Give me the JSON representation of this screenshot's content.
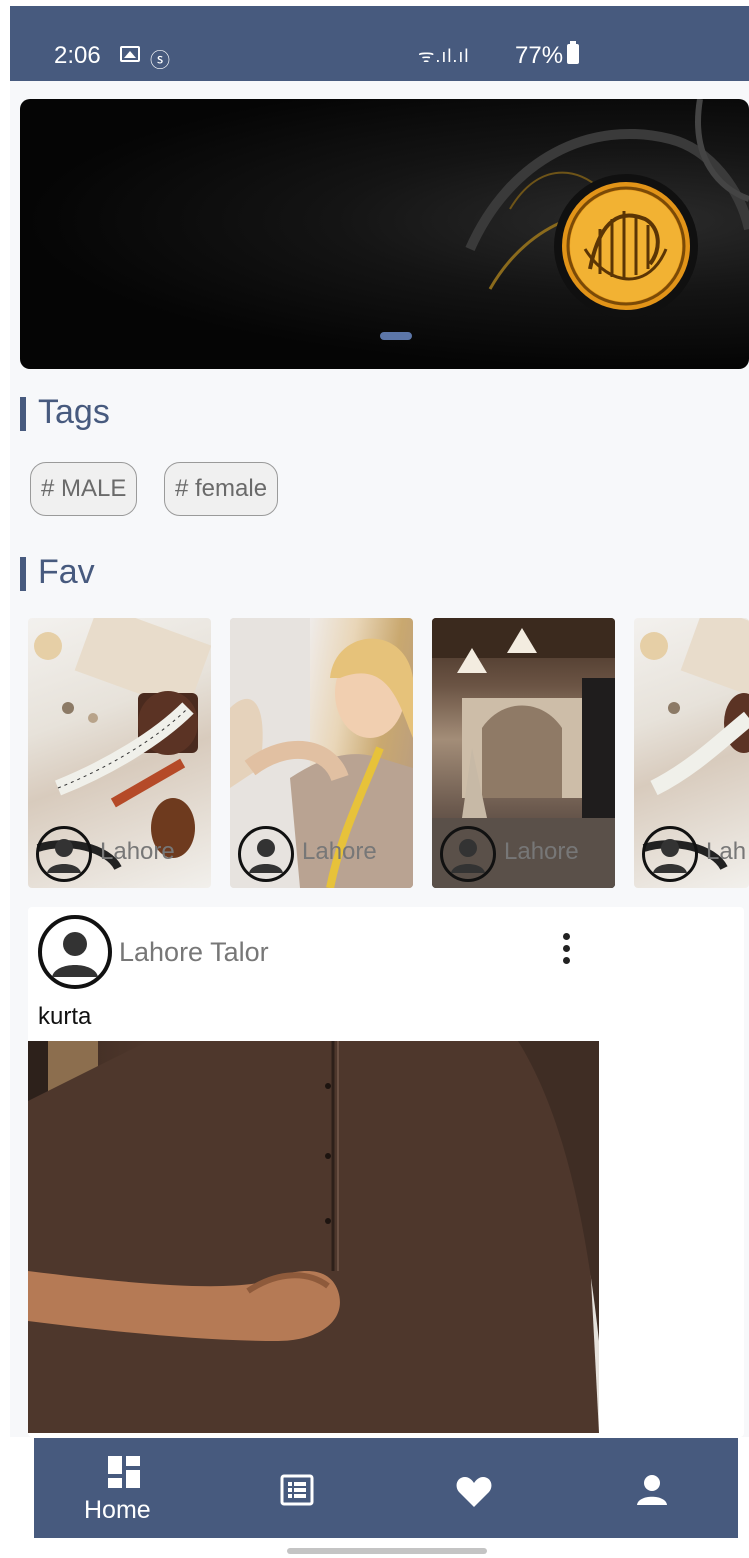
{
  "status_bar": {
    "time": "2:06",
    "battery_percent": "77%",
    "signal_text": "ᯤ.ıl.ıl",
    "notification_icon": "ⓢ",
    "icons": [
      "gallery-icon",
      "notification-icon",
      "wifi-icon",
      "signal-icon",
      "battery-icon"
    ]
  },
  "banner": {
    "carousel_page": 1
  },
  "tags": {
    "title": "Tags",
    "items": [
      "# MALE",
      "# female"
    ]
  },
  "fav": {
    "title": "Fav",
    "items": [
      {
        "location": "Lahore"
      },
      {
        "location": "Lahore"
      },
      {
        "location": "Lahore"
      },
      {
        "location": "Lah"
      }
    ]
  },
  "post": {
    "author": "Lahore Talor",
    "caption": "kurta",
    "menu_icon": "more-vertical-icon"
  },
  "bottom_nav": {
    "items": [
      {
        "label": "Home",
        "icon": "dashboard-icon",
        "active": true
      },
      {
        "icon": "list-icon"
      },
      {
        "icon": "heart-icon"
      },
      {
        "icon": "person-icon"
      }
    ]
  },
  "colors": {
    "primary": "#475a7e",
    "indicator": "#5c76a8",
    "background": "#f7f8fa"
  }
}
